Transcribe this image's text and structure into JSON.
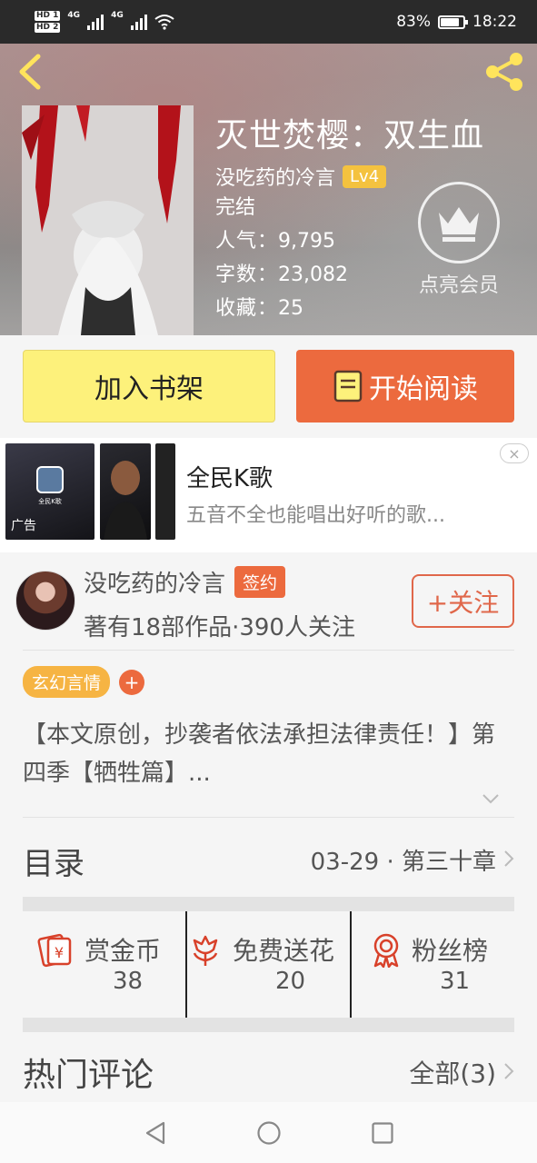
{
  "status_bar": {
    "hd1": "HD 1",
    "hd2": "HD 2",
    "network1": "4G",
    "network2": "4G",
    "battery": "83%",
    "time": "18:22"
  },
  "book": {
    "title": "灭世焚樱：双生血",
    "author": "没吃药的冷言",
    "level": "Lv4",
    "status": "完结",
    "popularity_label": "人气：",
    "popularity": "9,795",
    "words_label": "字数：",
    "words": "23,082",
    "favorites_label": "收藏：",
    "favorites": "25"
  },
  "vip": {
    "label": "点亮会员"
  },
  "actions": {
    "add_shelf": "加入书架",
    "start_read": "开始阅读"
  },
  "ad": {
    "title": "全民K歌",
    "subtitle": "五音不全也能唱出好听的歌...",
    "tag": "广告",
    "thumb_title": "全民K歌",
    "close": "×"
  },
  "author_card": {
    "name": "没吃药的冷言",
    "signed": "签约",
    "stats": "著有18部作品·390人关注",
    "follow": "+关注"
  },
  "tags": {
    "genre": "玄幻言情",
    "add": "+"
  },
  "description": "【本文原创，抄袭者依法承担法律责任！】第四季【牺牲篇】...",
  "toc": {
    "title": "目录",
    "latest": "03-29 · 第三十章"
  },
  "stats": [
    {
      "label": "赏金币",
      "value": "38",
      "icon": "red-envelope-icon"
    },
    {
      "label": "免费送花",
      "value": "20",
      "icon": "flower-icon"
    },
    {
      "label": "粉丝榜",
      "value": "31",
      "icon": "medal-icon"
    }
  ],
  "comments": {
    "title": "热门评论",
    "all": "全部(3)"
  },
  "colors": {
    "accent": "#ec6a3e",
    "shelf_button": "#fdf17b",
    "level_badge": "#f4c23f",
    "genre_tag": "#f6b443"
  }
}
